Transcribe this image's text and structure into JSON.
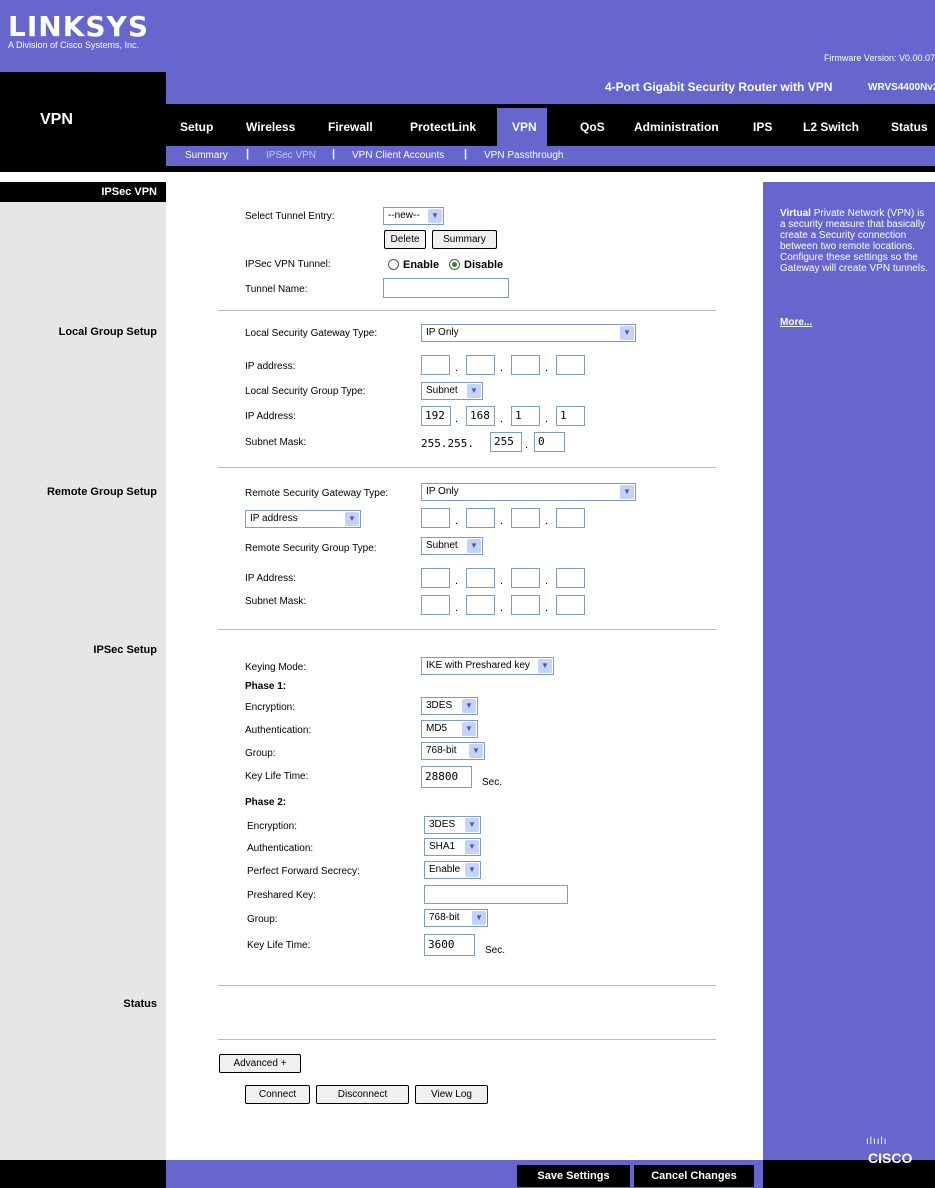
{
  "header": {
    "logo": "LINKSYS",
    "logo_sub": "A Division of Cisco Systems, Inc.",
    "firmware": "Firmware Version: V0.00.07",
    "product_name": "4-Port Gigabit Security Router with VPN",
    "model": "WRVS4400Nv2",
    "section_title": "VPN",
    "nav": [
      "Setup",
      "Wireless",
      "Firewall",
      "ProtectLink",
      "VPN",
      "QoS",
      "Administration",
      "IPS",
      "L2 Switch",
      "Status"
    ],
    "subnav": [
      "Summary",
      "IPSec VPN",
      "VPN Client Accounts",
      "VPN Passthrough"
    ]
  },
  "left": {
    "ipsec_vpn": "IPSec VPN",
    "local_group": "Local Group Setup",
    "remote_group": "Remote Group Setup",
    "ipsec_setup": "IPSec Setup",
    "status": "Status"
  },
  "tunnel": {
    "select_label": "Select Tunnel Entry:",
    "select_value": "--new--",
    "delete": "Delete",
    "summary": "Summary",
    "vpn_tunnel_label": "IPSec VPN Tunnel:",
    "enable": "Enable",
    "disable": "Disable",
    "name_label": "Tunnel Name:"
  },
  "local": {
    "gw_type_label": "Local Security Gateway Type:",
    "gw_type_value": "IP Only",
    "ip_label": "IP address:",
    "group_type_label": "Local Security Group Type:",
    "group_type_value": "Subnet",
    "ip_address_label": "IP Address:",
    "ip": [
      "192",
      "168",
      "1",
      "1"
    ],
    "mask_label": "Subnet Mask:",
    "mask_prefix": "255.255.",
    "mask": [
      "255",
      "0"
    ]
  },
  "remote": {
    "gw_type_label": "Remote Security Gateway Type:",
    "gw_type_value": "IP Only",
    "addr_type_value": "IP address",
    "group_type_label": "Remote Security Group Type:",
    "group_type_value": "Subnet",
    "ip_address_label": "IP Address:",
    "mask_label": "Subnet Mask:"
  },
  "ipsec": {
    "keying_label": "Keying Mode:",
    "keying_value": "IKE with Preshared key",
    "phase1": "Phase 1:",
    "p1_enc_label": "Encryption:",
    "p1_enc": "3DES",
    "p1_auth_label": "Authentication:",
    "p1_auth": "MD5",
    "p1_group_label": "Group:",
    "p1_group": "768-bit",
    "p1_life_label": "Key Life Time:",
    "p1_life": "28800",
    "sec": "Sec.",
    "phase2": "Phase 2:",
    "p2_enc_label": "Encryption:",
    "p2_enc": "3DES",
    "p2_auth_label": "Authentication:",
    "p2_auth": "SHA1",
    "pfs_label": "Perfect Forward Secrecy:",
    "pfs": "Enable",
    "psk_label": "Preshared Key:",
    "p2_group_label": "Group:",
    "p2_group": "768-bit",
    "p2_life_label": "Key Life Time:",
    "p2_life": "3600"
  },
  "actions": {
    "advanced": "Advanced +",
    "connect": "Connect",
    "disconnect": "Disconnect",
    "view_log": "View Log",
    "save": "Save Settings",
    "cancel": "Cancel Changes"
  },
  "help": {
    "lead": "Virtual",
    "text": " Private Network (VPN) is a security measure that basically create a Security connection between two remote locations. Configure these settings so the Gateway will create VPN tunnels.",
    "more": "More..."
  },
  "brand": {
    "cisco": "CISCO",
    "cisco_bars": "ılıılı"
  },
  "colors": {
    "brand": "#6666cc",
    "dark": "#000000",
    "side": "#e6e6e6"
  }
}
